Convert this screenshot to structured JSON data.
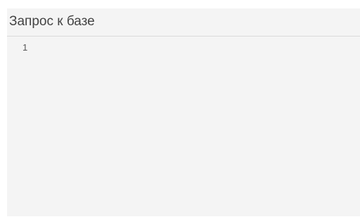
{
  "panel": {
    "title": "Запрос к базе"
  },
  "editor": {
    "lines": [
      {
        "number": "1",
        "content": ""
      }
    ]
  }
}
